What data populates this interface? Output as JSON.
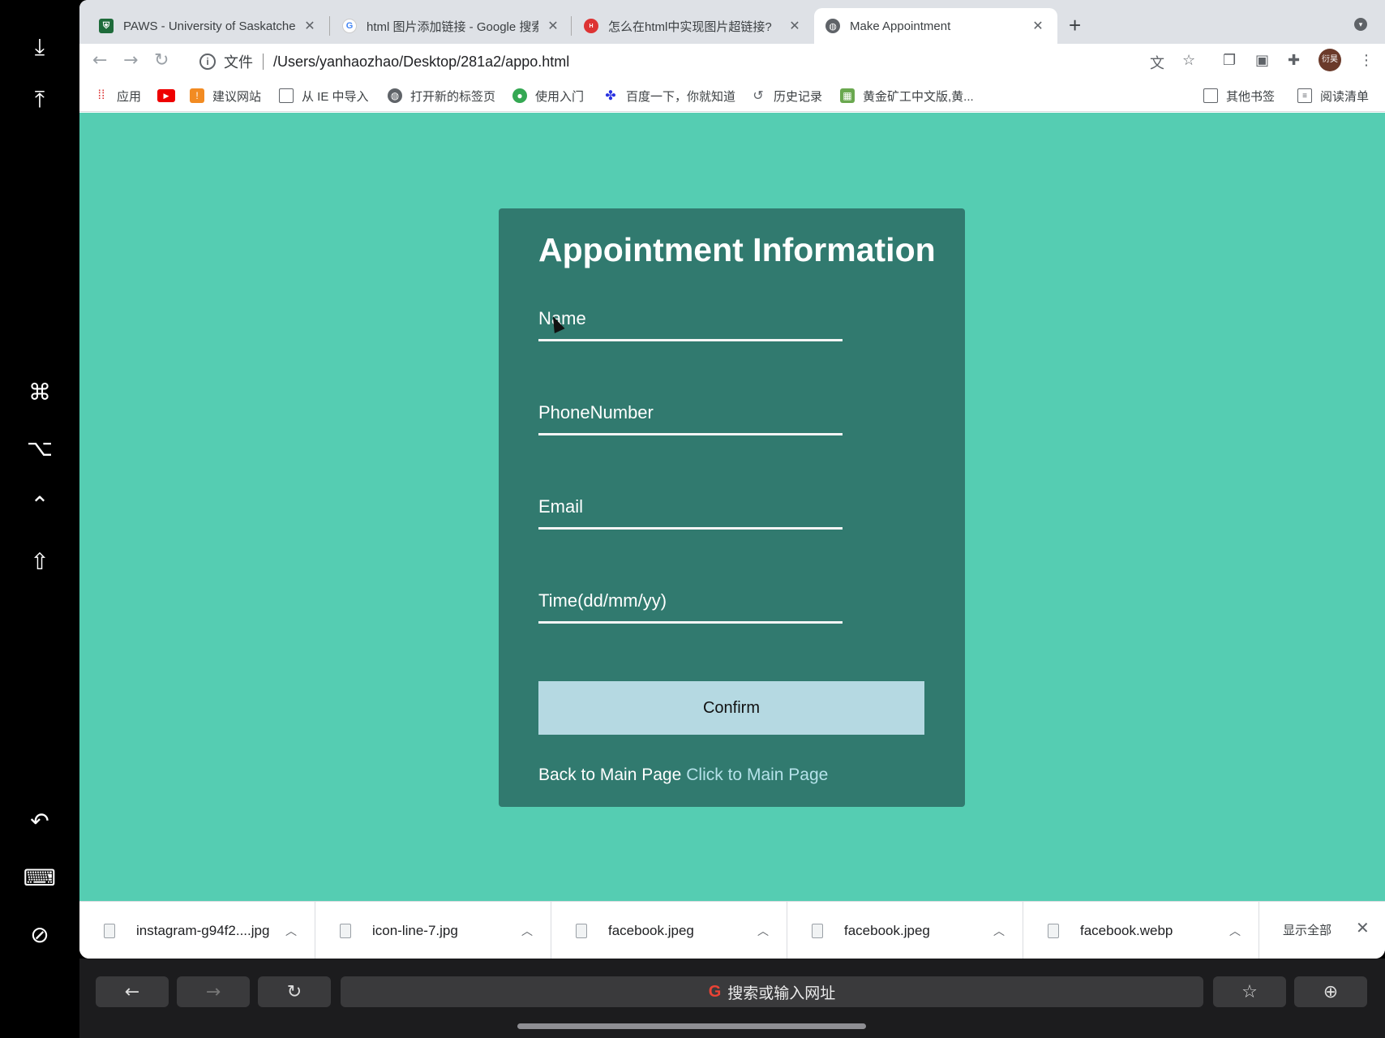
{
  "sidecar": {
    "icons": [
      "download-screen-icon",
      "upload-screen-icon",
      "command-key-icon",
      "option-key-icon",
      "control-key-icon",
      "shift-key-icon",
      "undo-icon",
      "keyboard-icon",
      "display-off-icon"
    ],
    "glyphs": [
      "⤓",
      "⤒",
      "⌘",
      "⌥",
      "⌃",
      "⇧",
      "↶",
      "⌨",
      "⊘"
    ]
  },
  "tabs": [
    {
      "title": "PAWS - University of Saskatchewan",
      "close": "✕"
    },
    {
      "title": "html 图片添加链接 - Google 搜索",
      "close": "✕"
    },
    {
      "title": "怎么在html中实现图片超链接?",
      "close": "✕"
    },
    {
      "title": "Make Appointment",
      "close": "✕"
    }
  ],
  "toolbar": {
    "back": "←",
    "forward": "→",
    "reload": "↻",
    "scheme_label": "文件",
    "url": "/Users/yanhaozhao/Desktop/281a2/appo.html",
    "avatar_text": "衍昊"
  },
  "bookmarks": {
    "items": [
      "应用",
      "",
      "建议网站",
      "从 IE 中导入",
      "打开新的标签页",
      "使用入门",
      "百度一下，你就知道",
      "历史记录",
      "黄金矿工中文版,黄..."
    ],
    "other": "其他书签",
    "reading_list": "阅读清单"
  },
  "form": {
    "title": "Appointment Information",
    "name_placeholder": "Name",
    "phone_placeholder": "PhoneNumber",
    "email_placeholder": "Email",
    "time_placeholder": "Time(dd/mm/yy)",
    "confirm_label": "Confirm",
    "back_text": "Back to Main Page",
    "back_link": "Click to Main Page"
  },
  "downloads": {
    "items": [
      "instagram-g94f2....jpg",
      "icon-line-7.jpg",
      "facebook.jpeg",
      "facebook.jpeg",
      "facebook.webp"
    ],
    "show_all": "显示全部",
    "close": "✕"
  },
  "touchbar": {
    "search_placeholder": "搜索或输入网址",
    "google_g": "G"
  },
  "colors": {
    "page_bg": "#55cdb2",
    "card_bg": "#317a6f",
    "button_bg": "#b5d9e2",
    "link": "#b5e2ea"
  }
}
